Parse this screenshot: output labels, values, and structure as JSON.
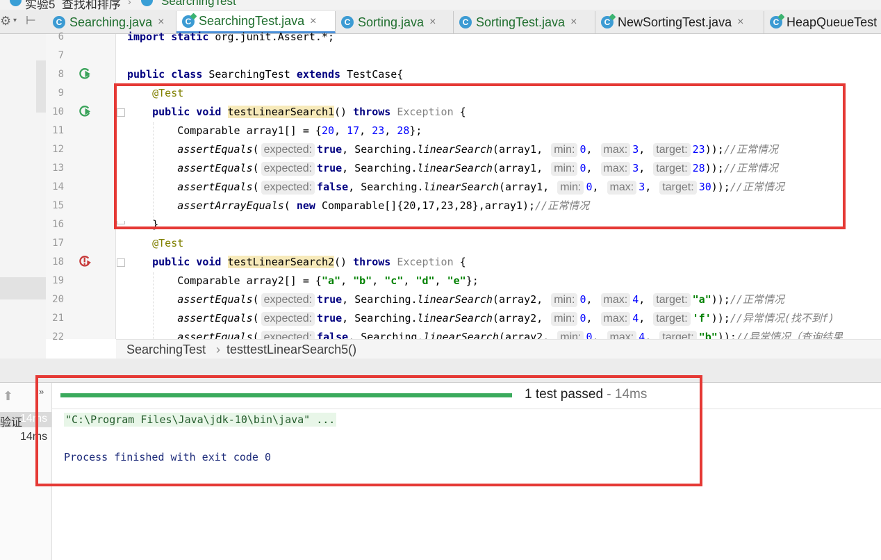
{
  "breadcrumb": {
    "project": "实验5_查找和排序",
    "file": "SearchingTest"
  },
  "tabs": [
    {
      "label": "Searching.java",
      "kind": "class"
    },
    {
      "label": "SearchingTest.java",
      "kind": "test",
      "active": true
    },
    {
      "label": "Sorting.java",
      "kind": "class"
    },
    {
      "label": "SortingTest.java",
      "kind": "class"
    },
    {
      "label": "NewSortingTest.java",
      "kind": "test"
    },
    {
      "label": "HeapQueueTest",
      "kind": "test"
    }
  ],
  "icons": {
    "class_letter": "C",
    "close": "×",
    "gear": "⚙",
    "caret": "▾",
    "pin": "⊢",
    "up": "⬆",
    "more": "»"
  },
  "editor": {
    "line_numbers": [
      "6",
      "7",
      "8",
      "9",
      "10",
      "11",
      "12",
      "13",
      "14",
      "15",
      "16",
      "17",
      "18",
      "19",
      "20",
      "21",
      "22"
    ],
    "gutter_markers": {
      "run_lines": [
        "8",
        "10"
      ],
      "error_lines": [
        "18"
      ]
    },
    "tokens": {
      "import": "import",
      "static": "static",
      "import_path": " org.junit.Assert.*;",
      "public": "public",
      "class": "class",
      "void": "void",
      "extends": "extends",
      "throws": "throws",
      "new": "new",
      "true": "true",
      "false": "false",
      "class_name": " SearchingTest ",
      "parent_class": " TestCase{",
      "annotation": "@Test",
      "method1": "testLinearSearch1",
      "method2": "testLinearSearch2",
      "exception": " Exception ",
      "comparable": "Comparable",
      "array1_decl": "Comparable array1[] = {",
      "array2_decl": "Comparable array2[] = {",
      "assertEquals": "assertEquals",
      "assertArrayEquals": "assertArrayEquals",
      "searching": " Searching.",
      "linearSearch": "linearSearch",
      "arr1": "(array1, ",
      "arr2": "(array2, ",
      "hint_expected": "expected:",
      "hint_min": "min:",
      "hint_max": "max:",
      "hint_target": "target:",
      "comment_normal": "//正常情况",
      "comment_abnormal_f": "//异常情况(找不到f)",
      "comment_abnormal_q": "//异常情况（查询结果"
    },
    "values": {
      "n20": "20",
      "n17": "17",
      "n23": "23",
      "n28": "28",
      "n30": "30",
      "n0": "0",
      "n3": "3",
      "n4": "4",
      "sa": "\"a\"",
      "sb": "\"b\"",
      "sc": "\"c\"",
      "sd": "\"d\"",
      "se": "\"e\"",
      "sf": "'f'",
      "new_array": "Comparable[]{20,17,23,28}",
      "array_tail": ",array1);"
    },
    "breadcrumb": {
      "class": "SearchingTest",
      "method": "testtestLinearSearch5()"
    }
  },
  "run": {
    "status_text": "1 test passed",
    "status_time": " - 14ms",
    "progress": 1.0,
    "tree": [
      {
        "label": "验证",
        "time": "14ms"
      },
      {
        "time": "14ms"
      }
    ],
    "console": {
      "command": "\"C:\\Program Files\\Java\\jdk-10\\bin\\java\" ...",
      "exit": "Process finished with exit code 0"
    }
  },
  "colors": {
    "highlight_box": "#e53935",
    "progress": "#3aaa5c",
    "active_tab": "#4a90d9"
  }
}
